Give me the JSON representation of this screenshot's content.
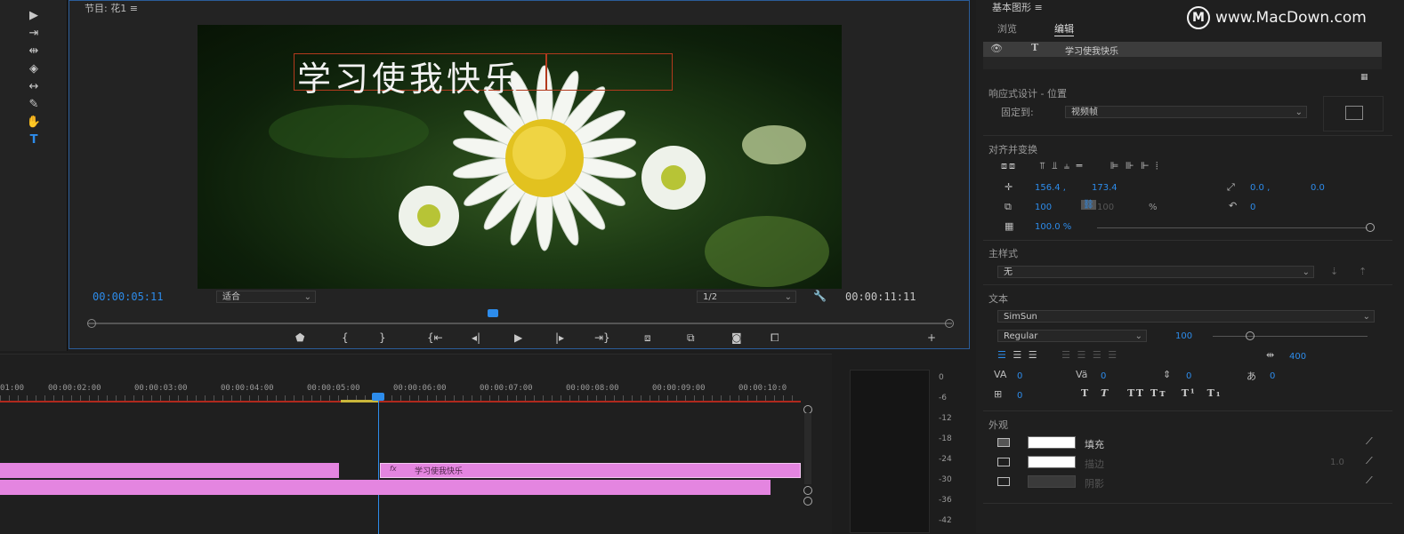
{
  "monitor": {
    "title": "节目: 花1 ≡",
    "title_text": "学习使我快乐",
    "timecode_current": "00:00:05:11",
    "timecode_duration": "00:00:11:11",
    "zoom_select": "适合",
    "resolution_select": "1/2"
  },
  "tools": [
    "selection-tool",
    "track-select-tool",
    "ripple-edit-tool",
    "razor-tool",
    "slip-tool",
    "pen-tool",
    "hand-tool",
    "type-tool"
  ],
  "timeline": {
    "ticks": [
      "01:00",
      "00:00:02:00",
      "00:00:03:00",
      "00:00:04:00",
      "00:00:05:00",
      "00:00:06:00",
      "00:00:07:00",
      "00:00:08:00",
      "00:00:09:00",
      "00:00:10:0"
    ],
    "clip_label": "学习使我快乐",
    "clip_badge": "fx"
  },
  "meter": {
    "labels": [
      "0",
      "-6",
      "-12",
      "-18",
      "-24",
      "-30",
      "-36",
      "-42"
    ]
  },
  "panel": {
    "title": "基本图形 ≡",
    "tab_browse": "浏览",
    "tab_edit": "编辑",
    "layer_name": "学习使我快乐",
    "responsive_label": "响应式设计 - 位置",
    "pin_to_label": "固定到:",
    "pin_to_value": "视频帧",
    "align_label": "对齐并变换",
    "pos_x": "156.4 ,",
    "pos_y": "173.4",
    "anchor_x": "0.0 ,",
    "anchor_y": "0.0",
    "scale": "100",
    "scale_h": "100",
    "percent": "%",
    "rotation": "0",
    "opacity": "100.0 %",
    "master_style_label": "主样式",
    "master_style_value": "无",
    "text_label": "文本",
    "font": "SimSun",
    "font_style": "Regular",
    "font_size": "100",
    "tracking": "400",
    "kerning": "0",
    "leading": "0",
    "baseline": "0",
    "tsume": "0",
    "tab_stops": "0",
    "appearance_label": "外观",
    "fill_label": "填充",
    "stroke_label": "描边",
    "shadow_label": "阴影",
    "stroke_width": "1.0"
  },
  "watermark": "www.MacDown.com"
}
